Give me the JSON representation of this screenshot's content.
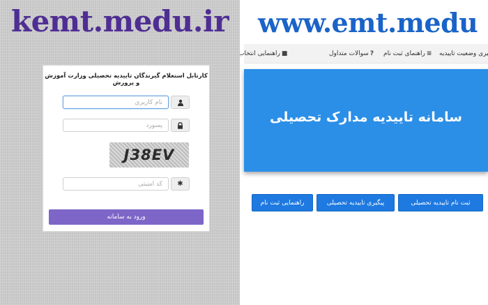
{
  "left": {
    "title": "kemt.medu.ir",
    "card_title": "کارتابل استعلام گیرندگان تاییدیه تحصیلی وزارت آموزش و پرورش",
    "username_placeholder": "نام کاربری",
    "password_placeholder": "پسورد",
    "captcha_text": "J38EV",
    "security_code_placeholder": "کد امنیتی",
    "login_button": "ورود به سامانه"
  },
  "right": {
    "title": "www.emt.medu",
    "nav": [
      {
        "label": "پیگیری وضعیت تاییدیه",
        "icon": "≡"
      },
      {
        "label": "راهنمای ثبت نام",
        "icon": "≡"
      },
      {
        "label": "سوالات متداول",
        "icon": "?"
      },
      {
        "label": "راهنمایی انتخاب",
        "icon": "■"
      }
    ],
    "banner_title": "سامانه تاییدیه مدارک تحصیلی",
    "buttons": [
      "ثبت نام تاییدیه تحصیلی",
      "پیگیری تاییدیه تحصیلی",
      "راهنمایی ثبت نام"
    ]
  }
}
